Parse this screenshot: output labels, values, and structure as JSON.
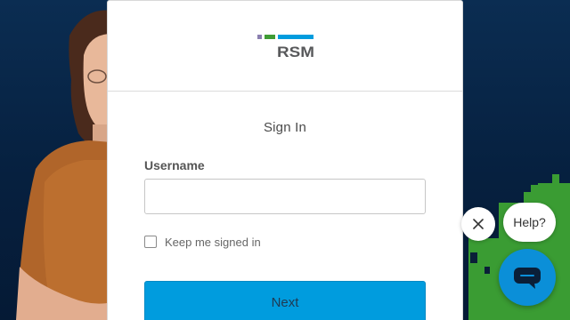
{
  "brand": {
    "name": "RSM",
    "colors": {
      "purple": "#8b7fb0",
      "green": "#3f9c35",
      "blue": "#009cde",
      "gray_text": "#58595b"
    }
  },
  "signin": {
    "title": "Sign In",
    "username_label": "Username",
    "username_value": "",
    "username_placeholder": "",
    "remember_label": "Keep me signed in",
    "remember_checked": false,
    "next_label": "Next"
  },
  "chat_widget": {
    "help_label": "Help?",
    "close_icon": "close-icon",
    "chat_icon": "chat-bubble-icon"
  },
  "theme": {
    "background": "#06203f",
    "primary_button": "#009cde"
  }
}
